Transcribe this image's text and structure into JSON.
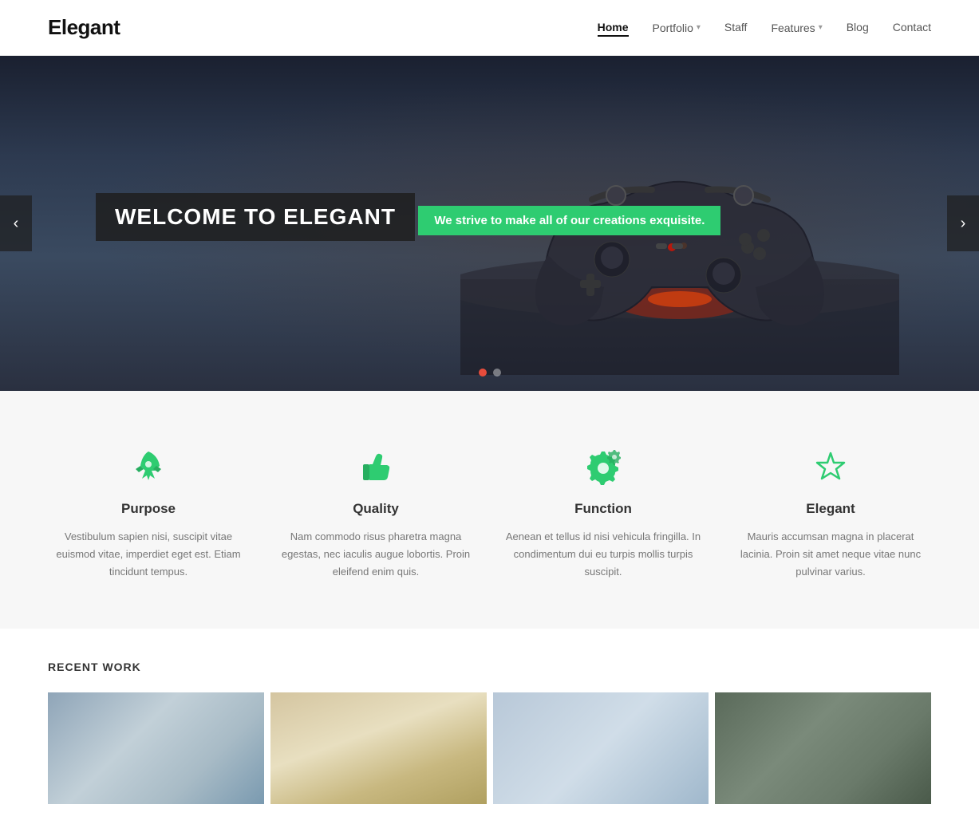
{
  "header": {
    "logo": "Elegant",
    "nav": [
      {
        "label": "Home",
        "active": true,
        "hasDropdown": false
      },
      {
        "label": "Portfolio",
        "active": false,
        "hasDropdown": true
      },
      {
        "label": "Staff",
        "active": false,
        "hasDropdown": false
      },
      {
        "label": "Features",
        "active": false,
        "hasDropdown": true
      },
      {
        "label": "Blog",
        "active": false,
        "hasDropdown": false
      },
      {
        "label": "Contact",
        "active": false,
        "hasDropdown": false
      }
    ]
  },
  "hero": {
    "title": "WELCOME TO ELEGANT",
    "subtitle": "We strive to make all of our creations exquisite.",
    "dots": [
      {
        "active": true
      },
      {
        "active": false
      }
    ]
  },
  "features": {
    "items": [
      {
        "id": "purpose",
        "icon": "rocket",
        "title": "Purpose",
        "description": "Vestibulum sapien nisi, suscipit vitae euismod vitae, imperdiet eget est. Etiam tincidunt tempus."
      },
      {
        "id": "quality",
        "icon": "thumbsup",
        "title": "Quality",
        "description": "Nam commodo risus pharetra magna egestas, nec iaculis augue lobortis. Proin eleifend enim quis."
      },
      {
        "id": "function",
        "icon": "gear",
        "title": "Function",
        "description": "Aenean et tellus id nisi vehicula fringilla. In condimentum dui eu turpis mollis turpis suscipit."
      },
      {
        "id": "elegant",
        "icon": "star",
        "title": "Elegant",
        "description": "Mauris accumsan magna in placerat lacinia. Proin sit amet neque vitae nunc pulvinar varius."
      }
    ]
  },
  "recentWork": {
    "sectionTitle": "RECENT WORK",
    "items": [
      {
        "alt": "City street photo"
      },
      {
        "alt": "Sunset landscape photo"
      },
      {
        "alt": "Mountain landscape photo"
      },
      {
        "alt": "Forest photo"
      }
    ]
  },
  "carousel": {
    "prevLabel": "‹",
    "nextLabel": "›"
  }
}
